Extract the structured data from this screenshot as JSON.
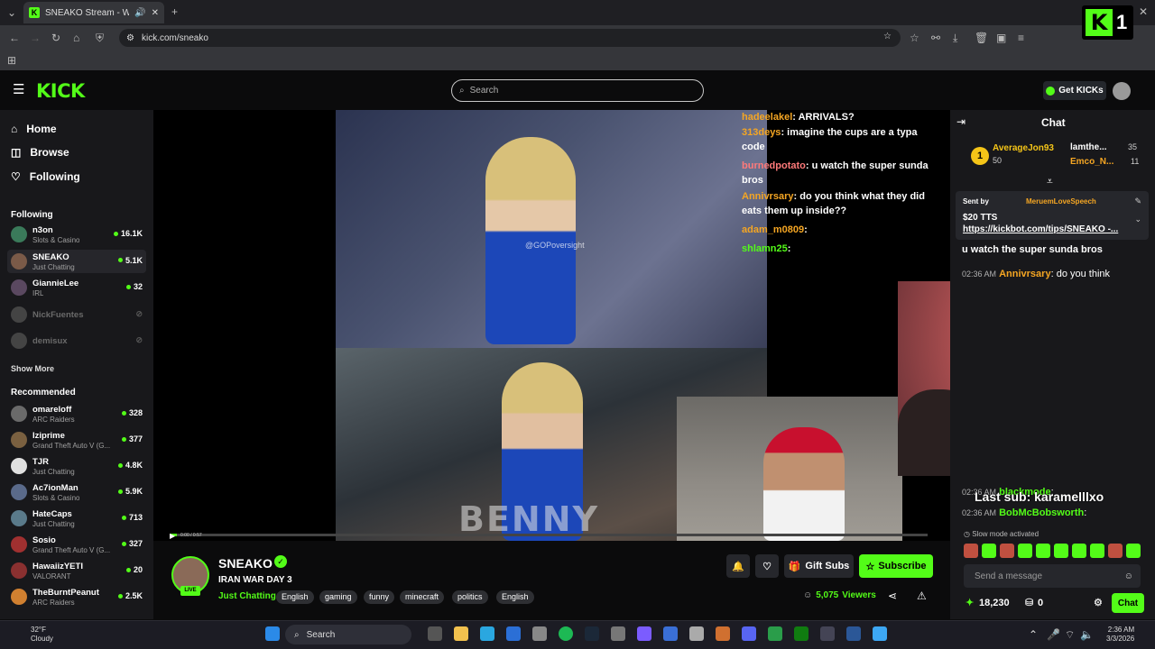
{
  "browser": {
    "tab_title": "SNEAKO Stream - Watch Li",
    "url": "kick.com/sneako"
  },
  "header": {
    "logo": "KICK",
    "search_placeholder": "Search",
    "get_kicks": "Get KICKs"
  },
  "sidebar": {
    "nav": [
      "Home",
      "Browse",
      "Following"
    ],
    "following_label": "Following",
    "following": [
      {
        "name": "n3on",
        "category": "Slots & Casino",
        "viewers": "16.1K",
        "color": "#3a7a5a"
      },
      {
        "name": "SNEAKO",
        "category": "Just Chatting",
        "viewers": "5.1K",
        "color": "#7a5a48"
      },
      {
        "name": "GiannieLee",
        "category": "IRL",
        "viewers": "32",
        "color": "#5a4860"
      },
      {
        "name": "NickFuentes",
        "category": "",
        "viewers": "",
        "color": "#444"
      },
      {
        "name": "demisux",
        "category": "",
        "viewers": "",
        "color": "#444"
      }
    ],
    "show_more": "Show More",
    "recommended_label": "Recommended",
    "recommended": [
      {
        "name": "omareloff",
        "category": "ARC Raiders",
        "viewers": "328",
        "color": "#6a6a6a"
      },
      {
        "name": "Iziprime",
        "category": "Grand Theft Auto V (G...",
        "viewers": "377",
        "color": "#7a6040"
      },
      {
        "name": "TJR",
        "category": "Just Chatting",
        "viewers": "4.8K",
        "color": "#e0e0e0"
      },
      {
        "name": "Ac7ionMan",
        "category": "Slots & Casino",
        "viewers": "5.9K",
        "color": "#5a6a8a"
      },
      {
        "name": "HateCaps",
        "category": "Just Chatting",
        "viewers": "713",
        "color": "#5a7a8a"
      },
      {
        "name": "Sosio",
        "category": "Grand Theft Auto V (G...",
        "viewers": "327",
        "color": "#a03030"
      },
      {
        "name": "HawaiizYETI",
        "category": "VALORANT",
        "viewers": "20",
        "color": "#8a3030"
      },
      {
        "name": "TheBurntPeanut",
        "category": "ARC Raiders",
        "viewers": "2.5K",
        "color": "#d08030"
      }
    ]
  },
  "video": {
    "watermark": "@GOPoversight",
    "overlay_text": "BENNY",
    "time": "0:00 / 0:57",
    "progress": 0.01,
    "overlay_chat": [
      {
        "user": "hadeelakel",
        "text": "ARRIVALS?"
      },
      {
        "user": "313deys",
        "text": "imagine the cups are a typa code"
      },
      {
        "user": "burnedpotato",
        "text": "u watch the super sunda bros"
      },
      {
        "user": "Annivrsary",
        "text": "do you think what they did eats them up inside??"
      },
      {
        "user": "adam_m0809",
        "text": ""
      },
      {
        "user": "shlamn25",
        "text": ""
      }
    ]
  },
  "channel": {
    "name": "SNEAKO",
    "title": "IRAN WAR DAY 3",
    "category": "Just Chatting",
    "tags": [
      "English",
      "gaming",
      "funny",
      "minecraft",
      "politics",
      "English"
    ],
    "live": "LIVE",
    "viewers": "5,075",
    "viewers_label": "Viewers",
    "gift_subs": "Gift Subs",
    "subscribe": "Subscribe"
  },
  "chat": {
    "title": "Chat",
    "leader1_name": "AverageJon93",
    "leader1_val": "50",
    "leader2_name": "lamthe...",
    "leader2_val": "35",
    "leader3_name": "Emco_N...",
    "leader3_val": "11",
    "rank": "1",
    "pinned_sent_by": "Sent by",
    "pinned_user": "MeruemLoveSpeech",
    "pinned_amount": "$20 TTS",
    "pinned_link": "https://kickbot.com/tips/SNEAKO -...",
    "messages": [
      {
        "time": "02:36 AM",
        "user": "burnedpotato",
        "text": "u watch the super sunda bros"
      },
      {
        "time": "02:36 AM",
        "user": "Annivrsary",
        "text": "do you think"
      },
      {
        "time": "02:36 AM",
        "user": "blackmode",
        "text": ""
      },
      {
        "time": "02:36 AM",
        "user": "BobMcBobsworth",
        "text": ""
      }
    ],
    "last_sub": "Last sub: karamelllxo",
    "slow_mode": "Slow mode activated",
    "placeholder": "Send a message",
    "points": "18,230",
    "count": "0",
    "chat_button": "Chat"
  },
  "badge": {
    "k": "K",
    "num": "1"
  },
  "taskbar": {
    "temp": "32°F",
    "weather": "Cloudy",
    "search": "Search",
    "time": "2:36 AM",
    "date": "3/3/2026"
  }
}
